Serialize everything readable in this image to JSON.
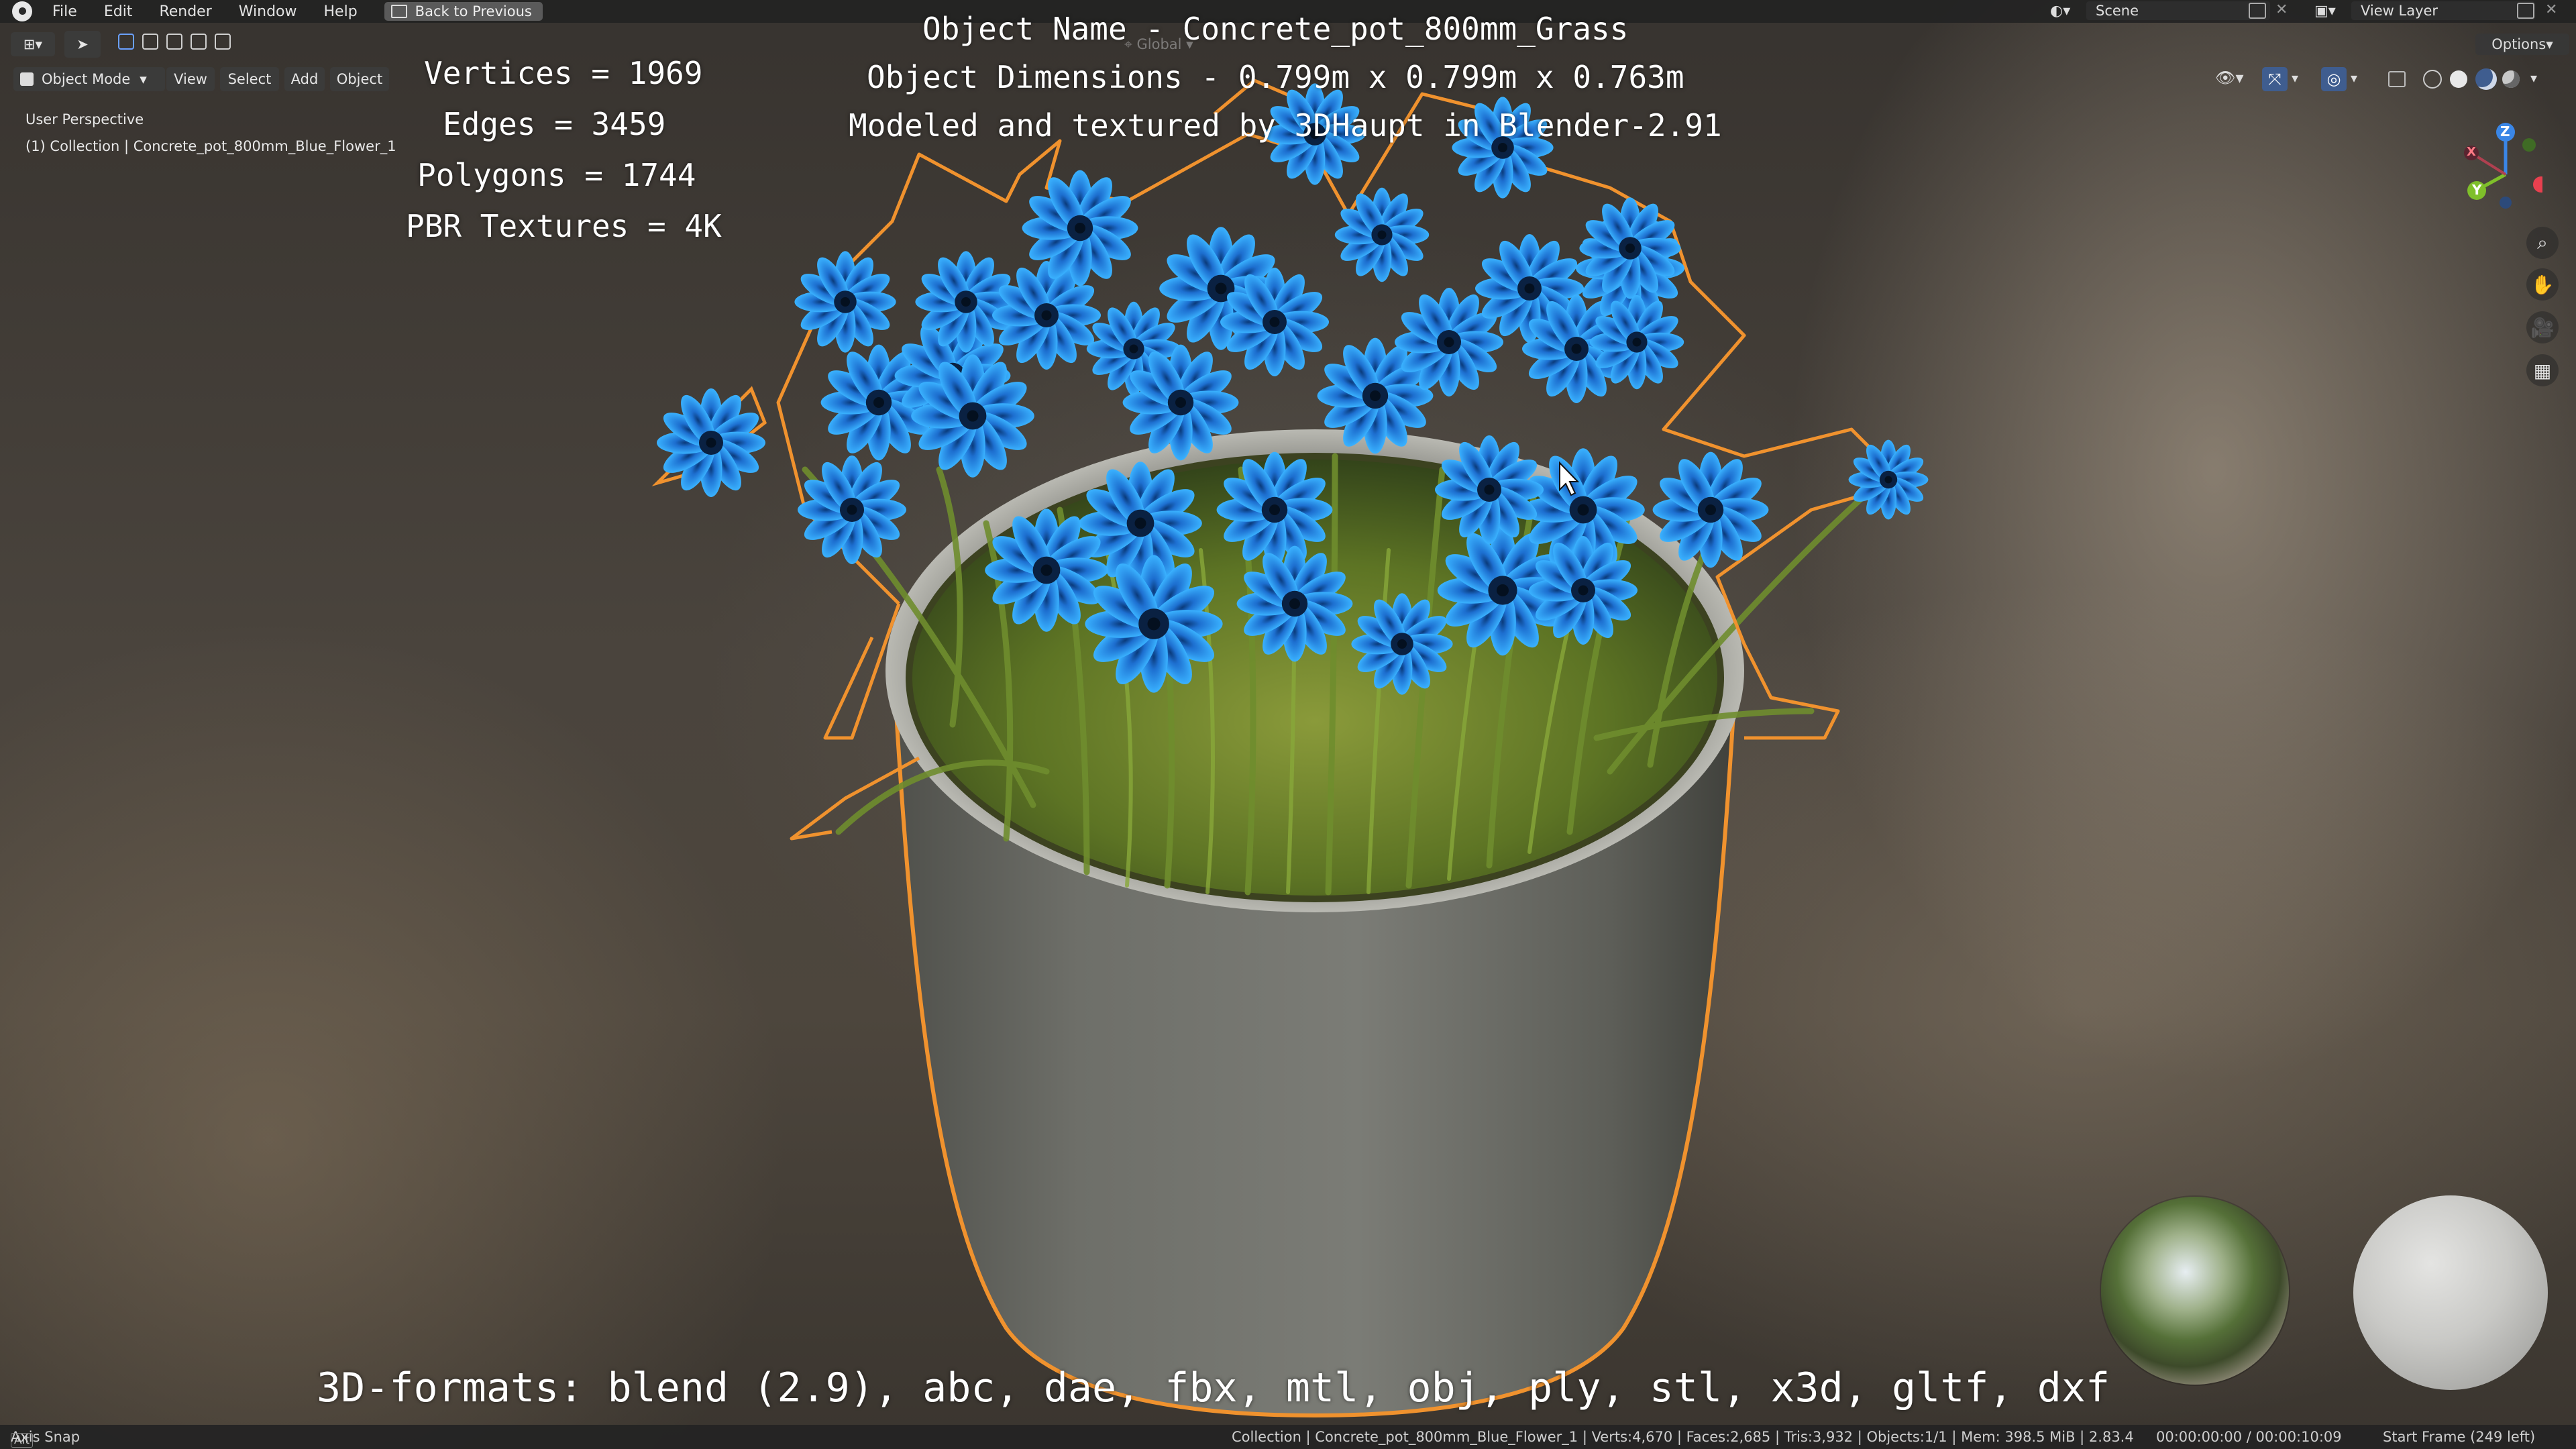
{
  "menu": {
    "items": [
      "File",
      "Edit",
      "Render",
      "Window",
      "Help"
    ],
    "back_button": "Back to Previous",
    "scene": "Scene",
    "view_layer": "View Layer",
    "options": "Options"
  },
  "header": {
    "mode": "Object Mode",
    "view": "View",
    "select": "Select",
    "add": "Add",
    "object": "Object",
    "orientation": "Global"
  },
  "viewport": {
    "perspective": "User Perspective",
    "collection": "(1) Collection | Concrete_pot_800mm_Blue_Flower_1"
  },
  "stats": {
    "vertices": "Vertices = 1969",
    "edges": "Edges = 3459",
    "polygons": "Polygons = 1744",
    "textures": "PBR Textures = 4K"
  },
  "info": {
    "object_name": "Object Name - Concrete_pot_800mm_Grass",
    "dimensions": "Object Dimensions -  0.799m x 0.799m x 0.763m",
    "credit": "Modeled and textured by 3DHaupt in Blender-2.91"
  },
  "formats": "3D-formats: blend (2.9), abc, dae, fbx, mtl, obj, ply, stl, x3d, gltf, dxf",
  "gizmo": {
    "x": "X",
    "y": "Y",
    "z": "Z"
  },
  "statusbar": {
    "key": "Alt",
    "hint": "Axis Snap",
    "stats": "Collection | Concrete_pot_800mm_Blue_Flower_1 | Verts:4,670 | Faces:2,685 | Tris:3,932 | Objects:1/1 | Mem: 398.5 MiB | 2.83.4",
    "time": "00:00:00:00 / 00:00:10:09",
    "frame": "Start Frame (249 left)"
  },
  "colors": {
    "selection_outline": "#f0922e",
    "flower_blue": "#1e8fe0",
    "flower_center": "#0a2a55",
    "pot": "#6b6c66",
    "grass": "#5f7a2a",
    "axis_x": "#e8404f",
    "axis_y": "#7fbf2a",
    "axis_z": "#3a86e6"
  }
}
